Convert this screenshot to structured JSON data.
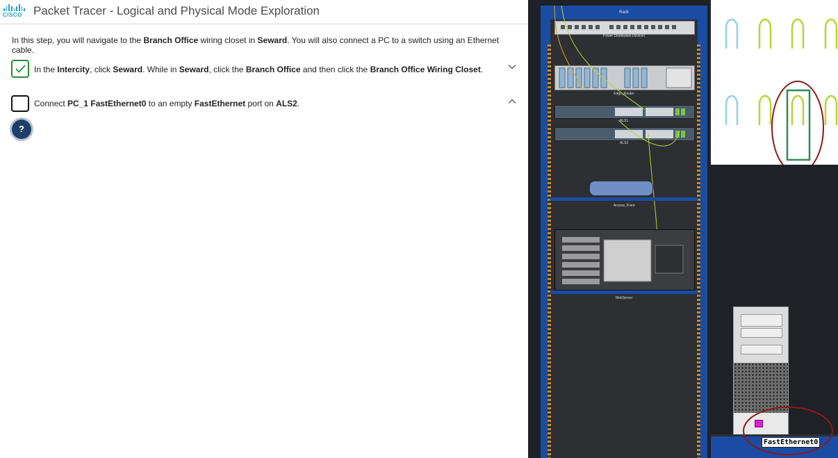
{
  "header": {
    "logo_text": "CISCO",
    "title": "Packet Tracer - Logical and Physical Mode Exploration"
  },
  "intro": {
    "parts": [
      "In this step, you will navigate to the ",
      "Branch Office",
      " wiring closet in ",
      "Seward",
      ". You will also connect a PC to a switch using an Ethernet cable."
    ]
  },
  "steps": [
    {
      "completed": true,
      "expanded": false,
      "parts": [
        "In the ",
        "Intercity",
        ", click ",
        "Seward",
        ". While in ",
        "Seward",
        ", click the ",
        "Branch Office",
        " and then click the ",
        "Branch Office Wiring Closet",
        "."
      ]
    },
    {
      "completed": false,
      "expanded": true,
      "parts": [
        "Connect ",
        "PC_1 FastEthernet0",
        " to an empty ",
        "FastEthernet",
        " port on ",
        "ALS2",
        "."
      ]
    }
  ],
  "help_label": "?",
  "physical_view": {
    "rack_label": "Rack",
    "devices": [
      "Power Distribution Device0",
      "Edge_Router",
      "ALS1",
      "ALS2",
      "Access_Point",
      "WebServer"
    ],
    "tooltip": "FastEthernet0",
    "splitter_grip": "⋮",
    "colors": {
      "rack_blue": "#1a4ca3",
      "straight_cable": "#b7d432",
      "crossover_cable": "#8fd0ee",
      "highlight_circle": "#8b1a1a",
      "selection_box": "#2e8b57",
      "port_highlight": "#e41bd5"
    }
  }
}
